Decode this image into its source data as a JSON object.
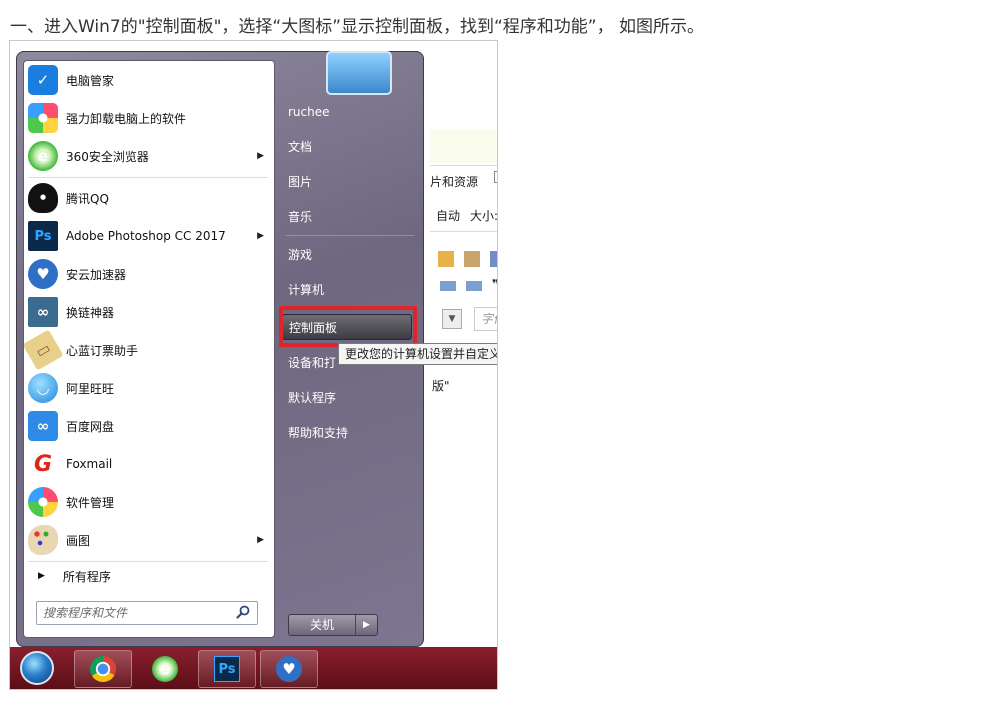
{
  "caption": "一、进入Win7的\"控制面板\"，选择“大图标”显示控制面板，找到“程序和功能”， 如图所示。",
  "start_menu": {
    "programs": [
      {
        "label": "电脑管家",
        "icon": "tencent-pc-manager-icon",
        "has_submenu": false
      },
      {
        "label": "强力卸载电脑上的软件",
        "icon": "flower-software-icon",
        "has_submenu": false
      },
      {
        "label": "360安全浏览器",
        "icon": "360-browser-icon",
        "has_submenu": true
      },
      {
        "label": "腾讯QQ",
        "icon": "qq-penguin-icon",
        "has_submenu": false
      },
      {
        "label": "Adobe Photoshop CC 2017",
        "icon": "photoshop-icon",
        "has_submenu": true
      },
      {
        "label": "安云加速器",
        "icon": "heart-shield-icon",
        "has_submenu": false
      },
      {
        "label": "换链神器",
        "icon": "link-chain-icon",
        "has_submenu": false
      },
      {
        "label": "心蓝订票助手",
        "icon": "ticket-icon",
        "has_submenu": false
      },
      {
        "label": "阿里旺旺",
        "icon": "aliwangwang-icon",
        "has_submenu": false
      },
      {
        "label": "百度网盘",
        "icon": "baidu-cloud-icon",
        "has_submenu": false
      },
      {
        "label": "Foxmail",
        "icon": "foxmail-icon",
        "has_submenu": false
      },
      {
        "label": "软件管理",
        "icon": "software-manager-icon",
        "has_submenu": false
      },
      {
        "label": "画图",
        "icon": "paint-palette-icon",
        "has_submenu": true
      }
    ],
    "all_programs": "所有程序",
    "search_placeholder": "搜索程序和文件",
    "right_items": {
      "user": "ruchee",
      "documents": "文档",
      "pictures": "图片",
      "music": "音乐",
      "games": "游戏",
      "computer": "计算机",
      "control_panel": "控制面板",
      "devices": "设备和打",
      "default_programs": "默认程序",
      "help": "帮助和支持"
    },
    "tooltip": "更改您的计算机设置并自定义",
    "shutdown": "关机"
  },
  "background_doc": {
    "pictures_resources": "片和资源",
    "auto": "自动",
    "size": "大小:",
    "font": "字体",
    "quote": "版\""
  },
  "taskbar": {
    "apps": [
      "chrome-icon",
      "360-browser-icon",
      "photoshop-icon",
      "heart-shield-icon"
    ]
  },
  "colors": {
    "highlight_border": "#e0252a",
    "taskbar": "#7a1624"
  }
}
